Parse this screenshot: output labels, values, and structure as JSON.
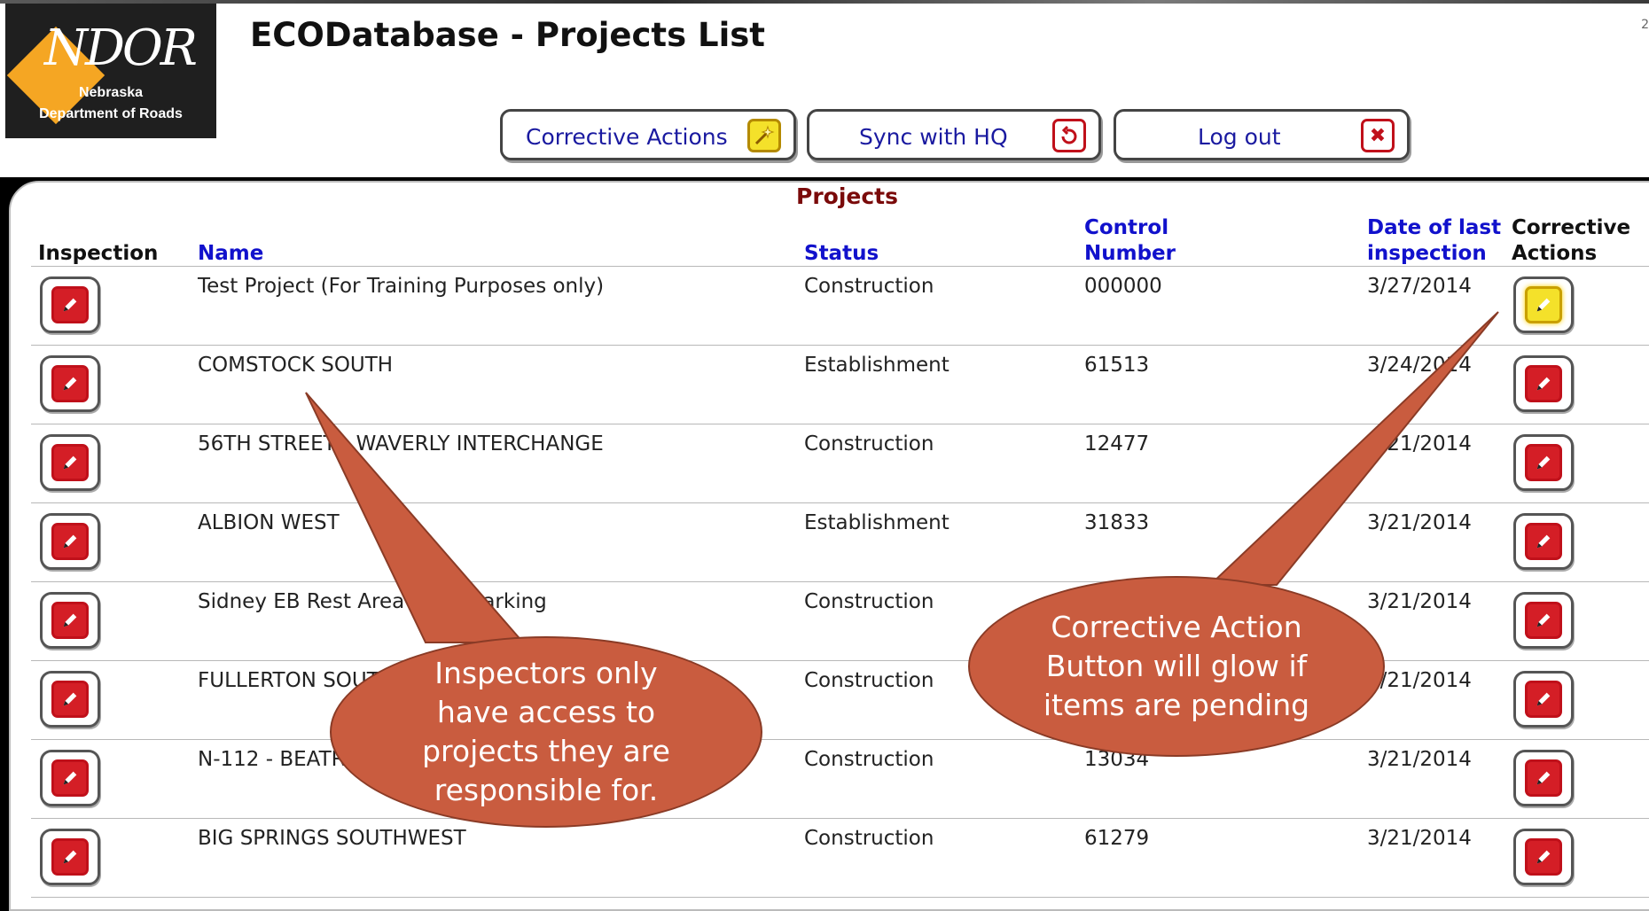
{
  "app": {
    "title": "ECODatabase - Projects List",
    "logo_mark": "NDOR",
    "logo_line1": "Nebraska",
    "logo_line2": "Department of Roads",
    "corner_text": "2"
  },
  "toolbar": {
    "corrective_actions_label": "Corrective Actions",
    "sync_label": "Sync with HQ",
    "logout_label": "Log out"
  },
  "projects": {
    "caption": "Projects",
    "headers": {
      "inspection": "Inspection",
      "name": "Name",
      "status": "Status",
      "control_line1": "Control",
      "control_line2": "Number",
      "date_line1": "Date of last",
      "date_line2": "inspection",
      "ca_line1": "Corrective",
      "ca_line2": "Actions"
    },
    "rows": [
      {
        "name": "Test Project (For Training Purposes only)",
        "status": "Construction",
        "control": "000000",
        "date": "3/27/2014",
        "pending": true
      },
      {
        "name": "COMSTOCK SOUTH",
        "status": "Establishment",
        "control": "61513",
        "date": "3/24/2014",
        "pending": false
      },
      {
        "name": "56TH STREET - WAVERLY INTERCHANGE",
        "status": "Construction",
        "control": "12477",
        "date": "3/21/2014",
        "pending": false
      },
      {
        "name": "ALBION WEST",
        "status": "Establishment",
        "control": "31833",
        "date": "3/21/2014",
        "pending": false
      },
      {
        "name": "Sidney EB Rest Area Truck Parking",
        "status": "Construction",
        "control": "",
        "date": "3/21/2014",
        "pending": false
      },
      {
        "name": "FULLERTON SOUTH",
        "status": "Construction",
        "control": "",
        "date": "3/21/2014",
        "pending": false
      },
      {
        "name": "N-112 - BEATRICE",
        "status": "Construction",
        "control": "13034",
        "date": "3/21/2014",
        "pending": false
      },
      {
        "name": "BIG SPRINGS SOUTHWEST",
        "status": "Construction",
        "control": "61279",
        "date": "3/21/2014",
        "pending": false
      }
    ]
  },
  "callouts": {
    "left_line1": "Inspectors only",
    "left_line2": "have access to",
    "left_line3": "projects they are",
    "left_line4": "responsible for.",
    "right_line1": "Corrective Action",
    "right_line2": "Button will glow if",
    "right_line3": "items are pending"
  },
  "colors": {
    "link_header": "#1111cc",
    "caption": "#7a0a0a",
    "edit_icon": "#d41e26",
    "pending_icon": "#f4e12a",
    "callout_fill": "#c95c3f"
  },
  "icons": {
    "corrective": "sparkle-icon",
    "sync": "sync-icon",
    "logout": "close-icon",
    "edit": "pencil-icon"
  }
}
